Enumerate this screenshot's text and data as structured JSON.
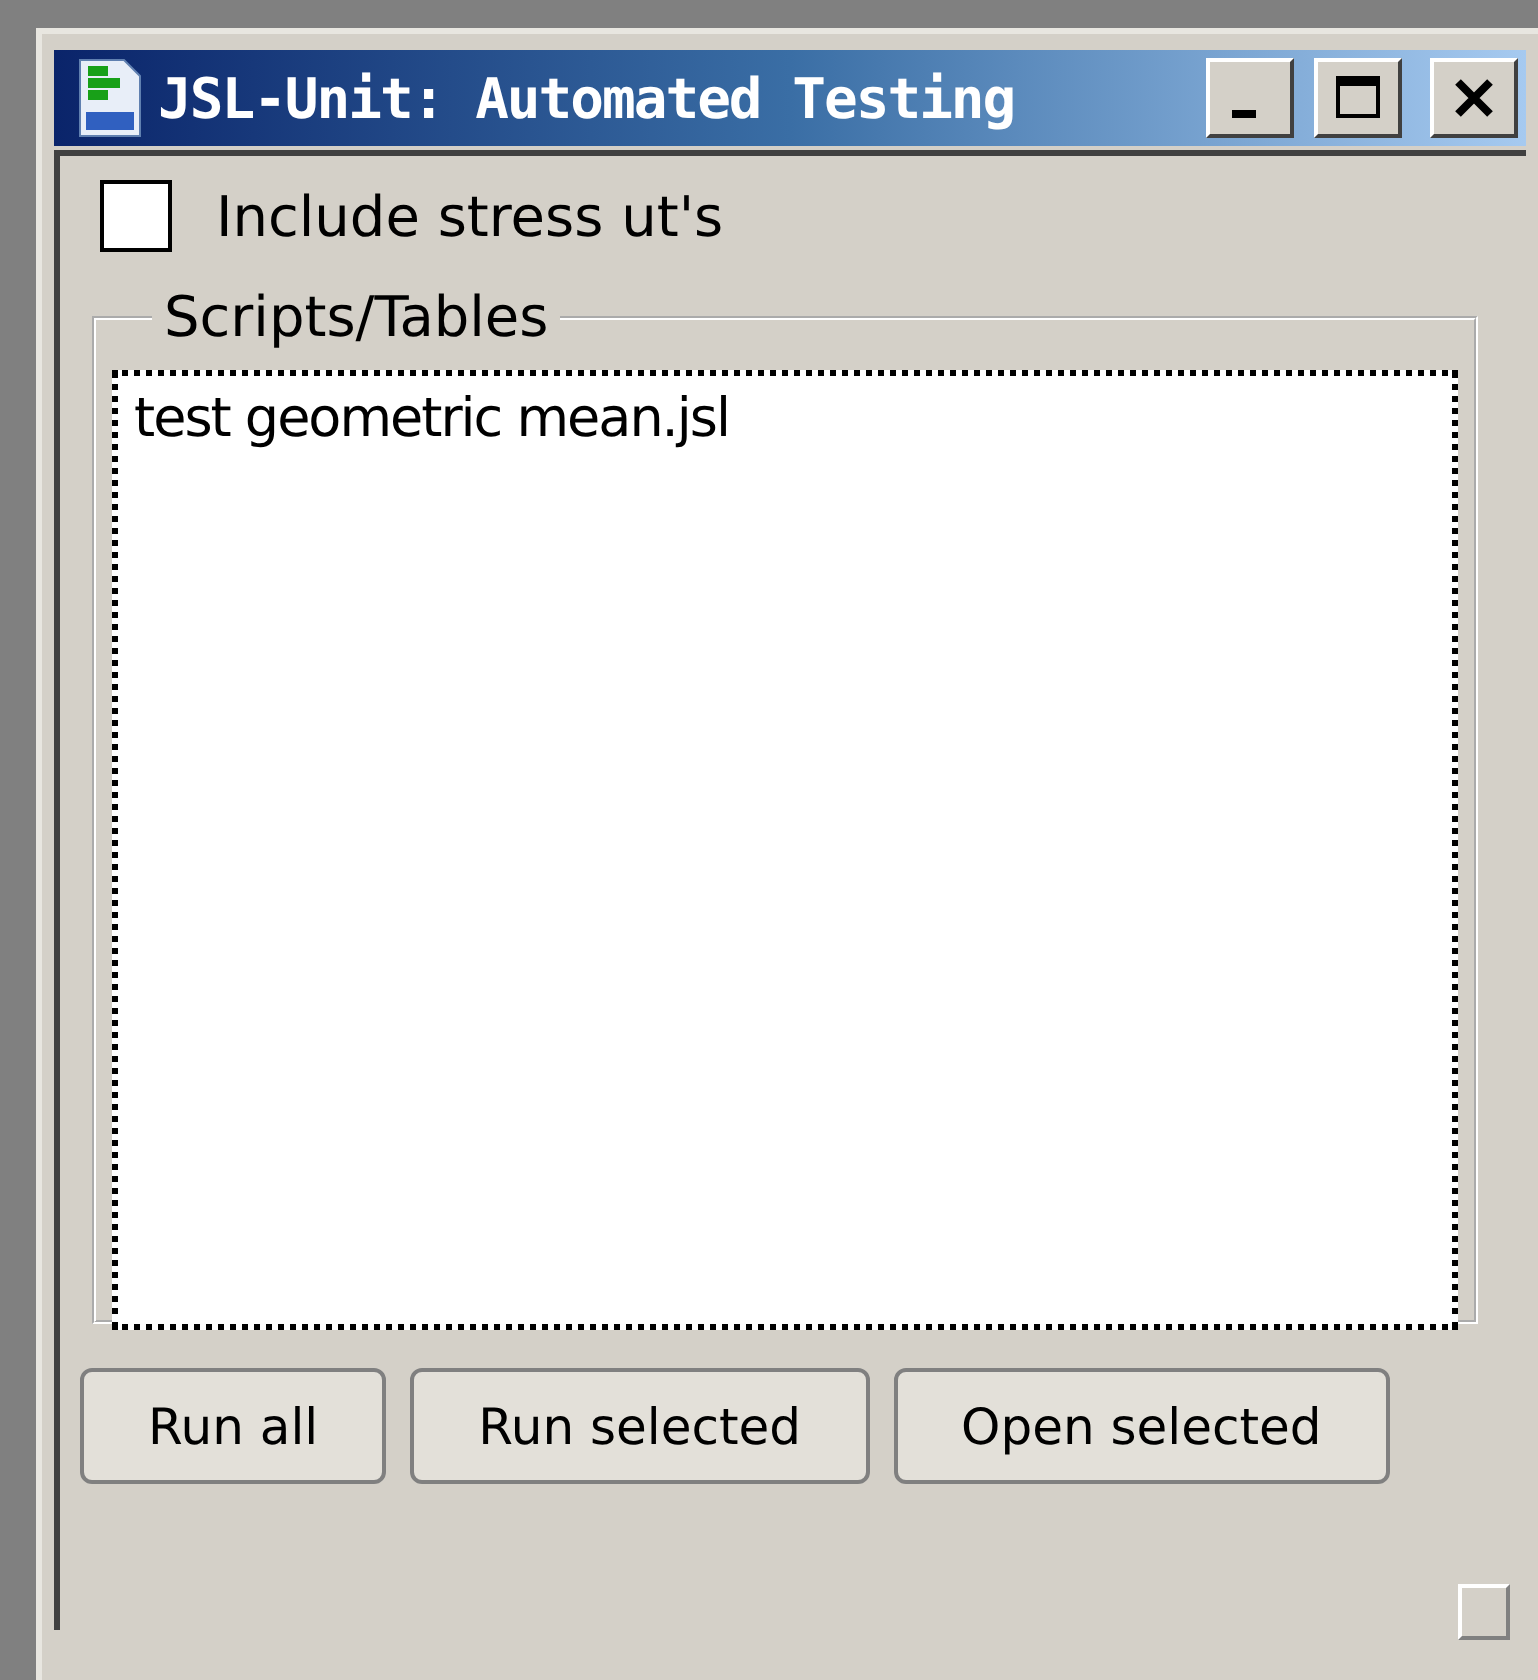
{
  "window": {
    "title": "JSL-Unit: Automated Testing"
  },
  "checkbox": {
    "label": "Include stress ut's",
    "checked": false
  },
  "group": {
    "title": "Scripts/Tables",
    "items": [
      "test geometric mean.jsl"
    ]
  },
  "buttons": [
    "Run all",
    "Run selected",
    "Open selected"
  ]
}
